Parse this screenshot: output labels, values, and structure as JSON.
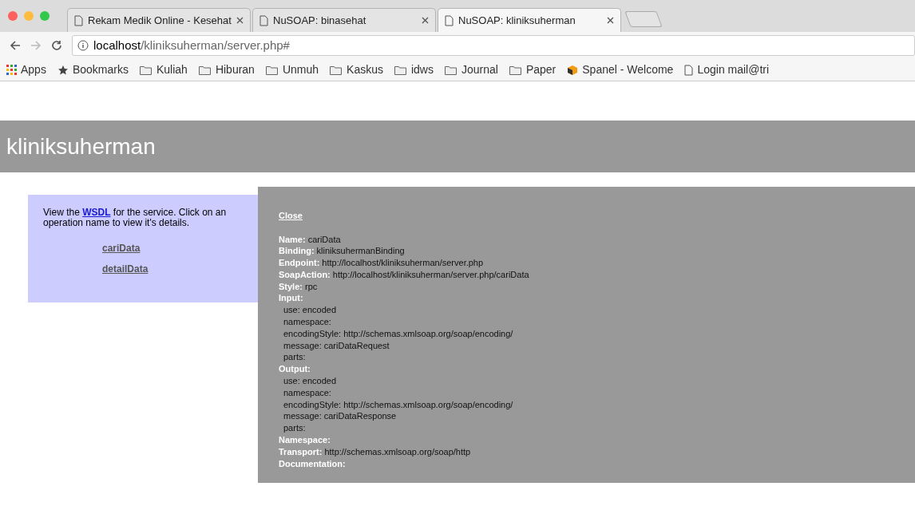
{
  "tabs": [
    {
      "title": "Rekam Medik Online - Kesehat",
      "selected": false
    },
    {
      "title": "NuSOAP: binasehat",
      "selected": false
    },
    {
      "title": "NuSOAP: kliniksuherman",
      "selected": true
    }
  ],
  "address_bar": {
    "host": "localhost",
    "path": "/kliniksuherman/server.php#"
  },
  "bookmarks": [
    {
      "kind": "apps",
      "label": "Apps"
    },
    {
      "kind": "star",
      "label": "Bookmarks"
    },
    {
      "kind": "folder",
      "label": "Kuliah"
    },
    {
      "kind": "folder",
      "label": "Hiburan"
    },
    {
      "kind": "folder",
      "label": "Unmuh"
    },
    {
      "kind": "folder",
      "label": "Kaskus"
    },
    {
      "kind": "folder",
      "label": "idws"
    },
    {
      "kind": "folder",
      "label": "Journal"
    },
    {
      "kind": "folder",
      "label": "Paper"
    },
    {
      "kind": "site",
      "label": "Spanel - Welcome"
    },
    {
      "kind": "page",
      "label": "Login mail@tri"
    }
  ],
  "page_title": "kliniksuherman",
  "intro": {
    "before": "View the",
    "link": "WSDL",
    "after": "for the service. Click on an operation name to view it's details."
  },
  "operations": [
    "cariData",
    "detailData"
  ],
  "details": {
    "close": "Close",
    "lines": [
      {
        "kind": "field",
        "label": "Name:",
        "value": "cariData"
      },
      {
        "kind": "field",
        "label": "Binding:",
        "value": "kliniksuhermanBinding"
      },
      {
        "kind": "field",
        "label": "Endpoint:",
        "value": "http://localhost/kliniksuherman/server.php"
      },
      {
        "kind": "field",
        "label": "SoapAction:",
        "value": "http://localhost/kliniksuherman/server.php/cariData"
      },
      {
        "kind": "field",
        "label": "Style:",
        "value": "rpc"
      },
      {
        "kind": "field",
        "label": "Input:"
      },
      {
        "kind": "sub",
        "text": "use: encoded"
      },
      {
        "kind": "sub",
        "text": "namespace:"
      },
      {
        "kind": "sub",
        "text": "encodingStyle: http://schemas.xmlsoap.org/soap/encoding/"
      },
      {
        "kind": "sub",
        "text": "message: cariDataRequest"
      },
      {
        "kind": "sub",
        "text": "parts:"
      },
      {
        "kind": "field",
        "label": "Output:"
      },
      {
        "kind": "sub",
        "text": "use: encoded"
      },
      {
        "kind": "sub",
        "text": "namespace:"
      },
      {
        "kind": "sub",
        "text": "encodingStyle: http://schemas.xmlsoap.org/soap/encoding/"
      },
      {
        "kind": "sub",
        "text": "message: cariDataResponse"
      },
      {
        "kind": "sub",
        "text": "parts:"
      },
      {
        "kind": "field",
        "label": "Namespace:"
      },
      {
        "kind": "field",
        "label": "Transport:",
        "value": "http://schemas.xmlsoap.org/soap/http"
      },
      {
        "kind": "field",
        "label": "Documentation:"
      }
    ]
  }
}
